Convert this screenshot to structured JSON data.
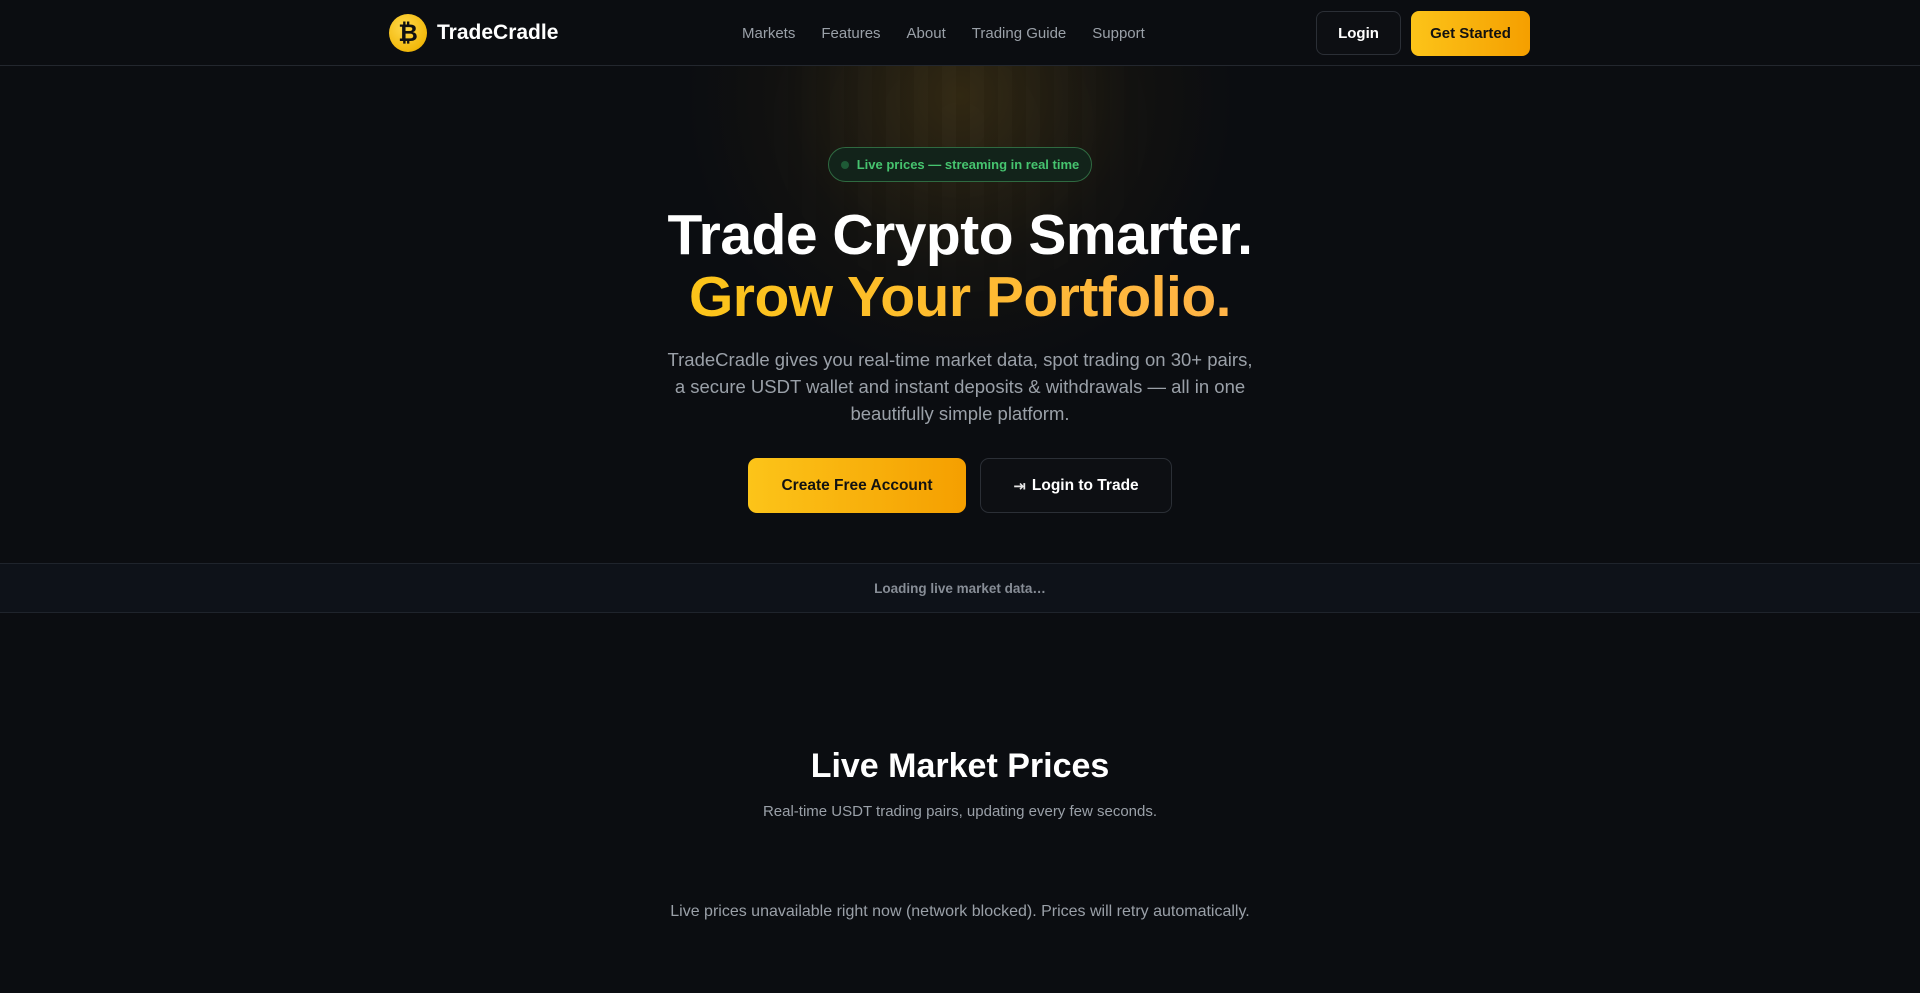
{
  "nav": {
    "brand_name": "TradeCradle",
    "links": [
      {
        "label": "Markets"
      },
      {
        "label": "Features"
      },
      {
        "label": "About"
      },
      {
        "label": "Trading Guide"
      },
      {
        "label": "Support"
      }
    ],
    "login_label": "Login",
    "get_started_label": "Get Started"
  },
  "hero": {
    "pill_text": "Live prices — streaming in real time",
    "headline_line1": "Trade Crypto Smarter.",
    "headline_line2": "Grow Your Portfolio.",
    "lead": "TradeCradle gives you real-time market data, spot trading on 30+ pairs, a secure USDT wallet and instant deposits & withdrawals — all in one beautifully simple platform.",
    "cta_primary": "Create Free Account",
    "cta_secondary": "Login to Trade"
  },
  "ticker": {
    "status": "Loading live market data…"
  },
  "market": {
    "title": "Live Market Prices",
    "subtitle": "Real-time USDT trading pairs, updating every few seconds.",
    "status": "Live prices unavailable right now (network blocked). Prices will retry automatically."
  },
  "colors": {
    "background": "#0b0d11",
    "accent_start": "#fcc419",
    "accent_end": "#f59f00",
    "live_green": "#46c46f"
  },
  "icons": {
    "brand": "bitcoin-coin-icon",
    "login_to_trade": "login-arrow-icon",
    "live": "live-dot-icon"
  }
}
